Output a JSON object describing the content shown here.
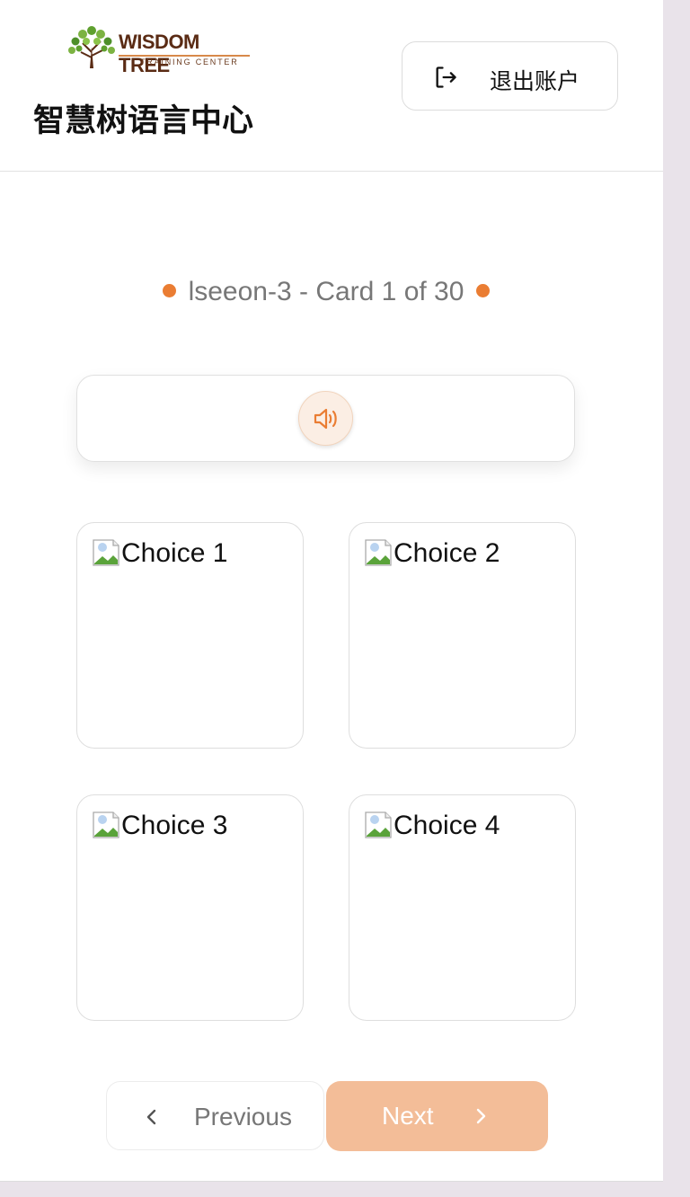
{
  "header": {
    "logo": {
      "wordmark": "WISDOM TREE",
      "tagline": "TRAINING CENTER"
    },
    "site_title": "智慧树语言中心",
    "logout_label": "退出账户"
  },
  "lesson": {
    "progress_text": "lseeon-3 - Card 1 of 30"
  },
  "choices": [
    {
      "alt": "Choice 1"
    },
    {
      "alt": "Choice 2"
    },
    {
      "alt": "Choice 3"
    },
    {
      "alt": "Choice 4"
    }
  ],
  "navigation": {
    "previous_label": "Previous",
    "next_label": "Next"
  },
  "colors": {
    "accent": "#ea7d33",
    "next_button": "#f3bd98",
    "audio_bg": "#fbeee4"
  },
  "icons": {
    "logout": "logout-icon",
    "audio": "speaker-icon",
    "broken_image": "broken-image-icon",
    "previous": "chevron-left-icon",
    "next": "chevron-right-icon"
  }
}
